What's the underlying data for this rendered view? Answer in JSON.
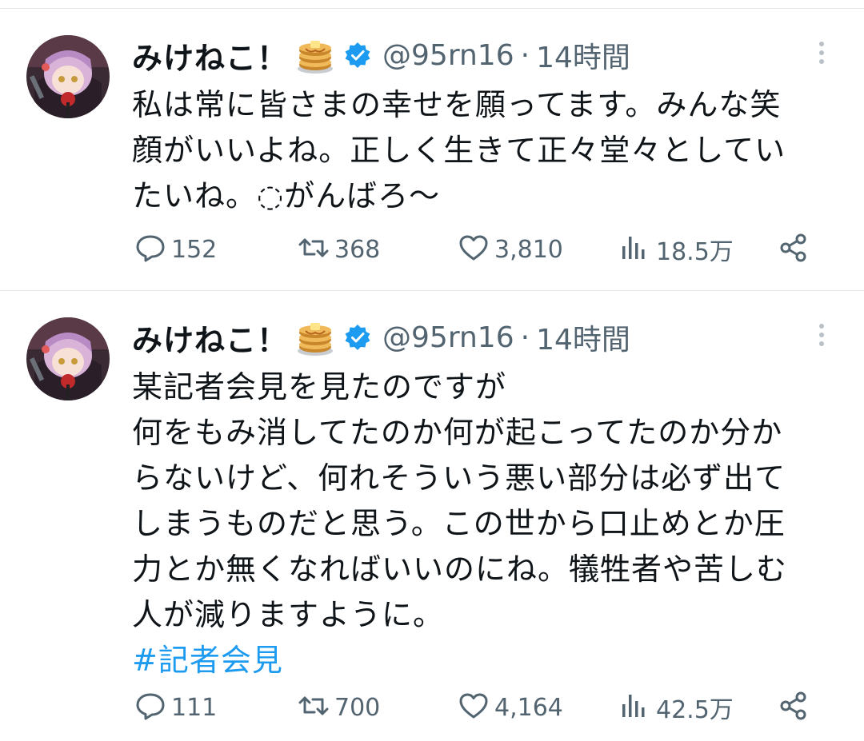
{
  "tweets": [
    {
      "display_name": "みけねこ！",
      "emoji_icon": "pancakes-icon",
      "handle": "@95rn16",
      "separator": "·",
      "time": "14時間",
      "text_lines": [
        "私は常に皆さまの幸せを願ってます。みんな笑",
        "顔がいいよね。正しく生きて正々堂々としてい",
        "たいね。◌がんばろ〜"
      ],
      "hashtag": "",
      "replies": "152",
      "retweets": "368",
      "likes": "3,810",
      "views": "18.5万"
    },
    {
      "display_name": "みけねこ！",
      "emoji_icon": "pancakes-icon",
      "handle": "@95rn16",
      "separator": "·",
      "time": "14時間",
      "text_lines": [
        "某記者会見を見たのですが",
        "何をもみ消してたのか何が起こってたのか分か",
        "らないけど、何れそういう悪い部分は必ず出て",
        "しまうものだと思う。この世から口止めとか圧",
        "力とか無くなればいいのにね。犠牲者や苦しむ",
        "人が減りますように。"
      ],
      "hashtag": "#記者会見",
      "replies": "111",
      "retweets": "700",
      "likes": "4,164",
      "views": "42.5万"
    }
  ],
  "colors": {
    "accent": "#1d9bf0",
    "secondary_text": "#536471",
    "primary_text": "#0f1419",
    "divider": "#e6e9ec"
  }
}
